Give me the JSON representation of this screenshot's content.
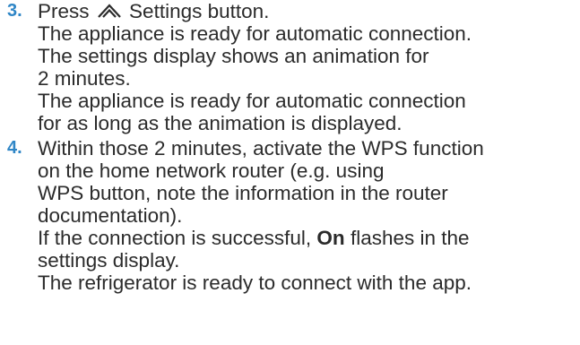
{
  "steps": [
    {
      "number": "3.",
      "action_before_icon": "Press",
      "icon": "settings-chevron-icon",
      "action_after_icon": "Settings button.",
      "result_lines": [
        "The appliance is ready for automatic connection.",
        "The settings display shows an animation for",
        "2 minutes.",
        "The appliance is ready for automatic connection",
        "for as long as the animation is displayed."
      ]
    },
    {
      "number": "4.",
      "action_lines": [
        "Within those 2 minutes, activate the WPS function",
        "on the home network router (e.g. using",
        "WPS button, note the information in the router",
        "documentation)."
      ],
      "success_before": "If the connection is successful,",
      "success_bold": "On",
      "success_after": "flashes in the",
      "success_line2": "settings display.",
      "final_line": "The refrigerator is ready to connect with the app."
    }
  ]
}
